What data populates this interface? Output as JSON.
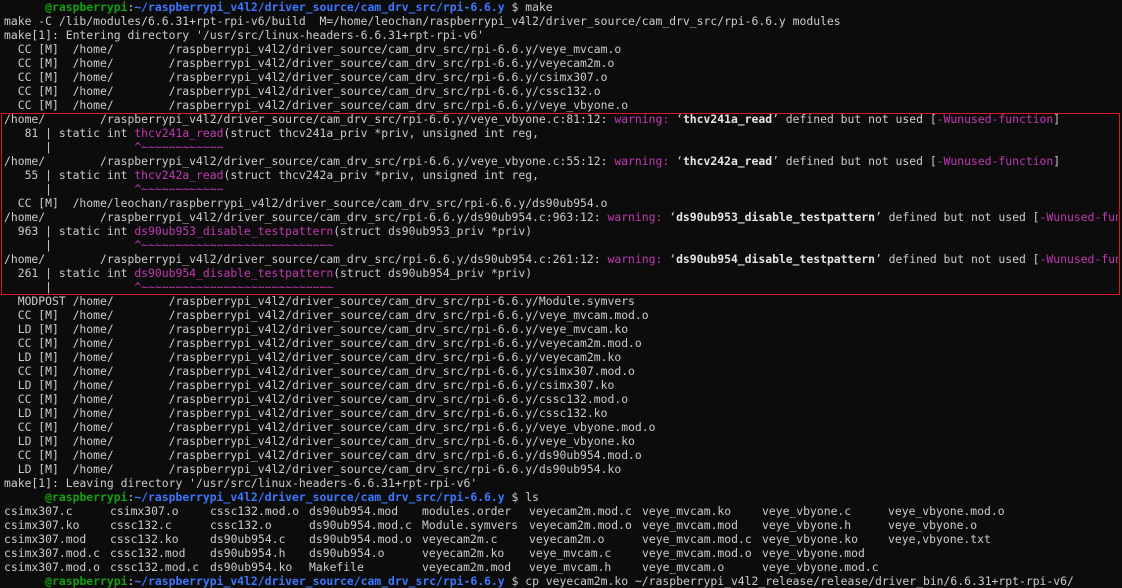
{
  "prompt": {
    "user": "@raspberrypi",
    "sep": ":",
    "path": "~/raspberrypi_v4l2/driver_source/cam_drv_src/rpi-6.6.y",
    "symbol": " $ "
  },
  "cmd_make": "make",
  "lines_a": [
    "make -C /lib/modules/6.6.31+rpt-rpi-v6/build  M=/home/leochan/raspberrypi_v4l2/driver_source/cam_drv_src/rpi-6.6.y modules",
    "make[1]: Entering directory '/usr/src/linux-headers-6.6.31+rpt-rpi-v6'",
    "  CC [M]  /home/        /raspberrypi_v4l2/driver_source/cam_drv_src/rpi-6.6.y/veye_mvcam.o",
    "  CC [M]  /home/        /raspberrypi_v4l2/driver_source/cam_drv_src/rpi-6.6.y/veyecam2m.o",
    "  CC [M]  /home/        /raspberrypi_v4l2/driver_source/cam_drv_src/rpi-6.6.y/csimx307.o",
    "  CC [M]  /home/        /raspberrypi_v4l2/driver_source/cam_drv_src/rpi-6.6.y/cssc132.o",
    "  CC [M]  /home/        /raspberrypi_v4l2/driver_source/cam_drv_src/rpi-6.6.y/veye_vbyone.o"
  ],
  "warnings": [
    {
      "file": "/home/        /raspberrypi_v4l2/driver_source/cam_drv_src/rpi-6.6.y/veye_vbyone.c:81:12: ",
      "label": "warning:",
      "msg_pre": " ‘",
      "func": "thcv241a_read",
      "msg_post": "’ defined but not used [",
      "flag": "-Wunused-function",
      "close": "]",
      "lineno": "   81 | static int ",
      "code_func": "thcv241a_read",
      "code_rest": "(struct thcv241a_priv *priv, unsigned int reg,",
      "caret_pre": "      |            ",
      "caret": "^~~~~~~~~~~~~"
    },
    {
      "file": "/home/        /raspberrypi_v4l2/driver_source/cam_drv_src/rpi-6.6.y/veye_vbyone.c:55:12: ",
      "label": "warning:",
      "msg_pre": " ‘",
      "func": "thcv242a_read",
      "msg_post": "’ defined but not used [",
      "flag": "-Wunused-function",
      "close": "]",
      "lineno": "   55 | static int ",
      "code_func": "thcv242a_read",
      "code_rest": "(struct thcv242a_priv *priv, unsigned int reg,",
      "caret_pre": "      |            ",
      "caret": "^~~~~~~~~~~~~"
    }
  ],
  "mid_line": "  CC [M]  /home/leochan/raspberrypi_v4l2/driver_source/cam_drv_src/rpi-6.6.y/ds90ub954.o",
  "warnings2": [
    {
      "file": "/home/        /raspberrypi_v4l2/driver_source/cam_drv_src/rpi-6.6.y/ds90ub954.c:963:12: ",
      "label": "warning:",
      "msg_pre": " ‘",
      "func": "ds90ub953_disable_testpattern",
      "msg_post": "’ defined but not used [",
      "flag": "-Wunused-function",
      "close": "]",
      "lineno": "  963 | static int ",
      "code_func": "ds90ub953_disable_testpattern",
      "code_rest": "(struct ds90ub953_priv *priv)",
      "caret_pre": "      |            ",
      "caret": "^~~~~~~~~~~~~~~~~~~~~~~~~~~~~"
    },
    {
      "file": "/home/        /raspberrypi_v4l2/driver_source/cam_drv_src/rpi-6.6.y/ds90ub954.c:261:12: ",
      "label": "warning:",
      "msg_pre": " ‘",
      "func": "ds90ub954_disable_testpattern",
      "msg_post": "’ defined but not used [",
      "flag": "-Wunused-function",
      "close": "]",
      "lineno": "  261 | static int ",
      "code_func": "ds90ub954_disable_testpattern",
      "code_rest": "(struct ds90ub954_priv *priv)",
      "caret_pre": "      |            ",
      "caret": "^~~~~~~~~~~~~~~~~~~~~~~~~~~~~"
    }
  ],
  "lines_b": [
    "  MODPOST /home/        /raspberrypi_v4l2/driver_source/cam_drv_src/rpi-6.6.y/Module.symvers",
    "  CC [M]  /home/        /raspberrypi_v4l2/driver_source/cam_drv_src/rpi-6.6.y/veye_mvcam.mod.o",
    "  LD [M]  /home/        /raspberrypi_v4l2/driver_source/cam_drv_src/rpi-6.6.y/veye_mvcam.ko",
    "  CC [M]  /home/        /raspberrypi_v4l2/driver_source/cam_drv_src/rpi-6.6.y/veyecam2m.mod.o",
    "  LD [M]  /home/        /raspberrypi_v4l2/driver_source/cam_drv_src/rpi-6.6.y/veyecam2m.ko",
    "  CC [M]  /home/        /raspberrypi_v4l2/driver_source/cam_drv_src/rpi-6.6.y/csimx307.mod.o",
    "  LD [M]  /home/        /raspberrypi_v4l2/driver_source/cam_drv_src/rpi-6.6.y/csimx307.ko",
    "  CC [M]  /home/        /raspberrypi_v4l2/driver_source/cam_drv_src/rpi-6.6.y/cssc132.mod.o",
    "  LD [M]  /home/        /raspberrypi_v4l2/driver_source/cam_drv_src/rpi-6.6.y/cssc132.ko",
    "  CC [M]  /home/        /raspberrypi_v4l2/driver_source/cam_drv_src/rpi-6.6.y/veye_vbyone.mod.o",
    "  LD [M]  /home/        /raspberrypi_v4l2/driver_source/cam_drv_src/rpi-6.6.y/veye_vbyone.ko",
    "  CC [M]  /home/        /raspberrypi_v4l2/driver_source/cam_drv_src/rpi-6.6.y/ds90ub954.mod.o",
    "  LD [M]  /home/        /raspberrypi_v4l2/driver_source/cam_drv_src/rpi-6.6.y/ds90ub954.ko",
    "make[1]: Leaving directory '/usr/src/linux-headers-6.6.31+rpt-rpi-v6'"
  ],
  "cmd_ls": "ls",
  "ls_rows": [
    [
      "csimx307.c",
      "csimx307.o",
      "cssc132.mod.o",
      "ds90ub954.mod",
      "modules.order",
      "veyecam2m.mod.c",
      "veye_mvcam.ko",
      "veye_vbyone.c",
      "veye_vbyone.mod.o"
    ],
    [
      "csimx307.ko",
      "cssc132.c",
      "cssc132.o",
      "ds90ub954.mod.c",
      "Module.symvers",
      "veyecam2m.mod.o",
      "veye_mvcam.mod",
      "veye_vbyone.h",
      "veye_vbyone.o"
    ],
    [
      "csimx307.mod",
      "cssc132.ko",
      "ds90ub954.c",
      "ds90ub954.mod.o",
      "veyecam2m.c",
      "veyecam2m.o",
      "veye_mvcam.mod.c",
      "veye_vbyone.ko",
      "veye,vbyone.txt"
    ],
    [
      "csimx307.mod.c",
      "cssc132.mod",
      "ds90ub954.h",
      "ds90ub954.o",
      "veyecam2m.ko",
      "veye_mvcam.c",
      "veye_mvcam.mod.o",
      "veye_vbyone.mod",
      ""
    ],
    [
      "csimx307.mod.o",
      "cssc132.mod.c",
      "ds90ub954.ko",
      "Makefile",
      "veyecam2m.mod",
      "veye_mvcam.h",
      "veye_mvcam.o",
      "veye_vbyone.mod.c",
      ""
    ]
  ],
  "cmd_cp": "cp veyecam2m.ko ~/raspberrypi_v4l2_release/release/driver_bin/6.6.31+rpt-rpi-v6/",
  "colors": {
    "background": "#0c0c0c",
    "text": "#cccccc",
    "prompt_user": "#13a10e",
    "prompt_path": "#3b78ff",
    "warning": "#c239b3",
    "highlight_box": "#d81b1b"
  }
}
